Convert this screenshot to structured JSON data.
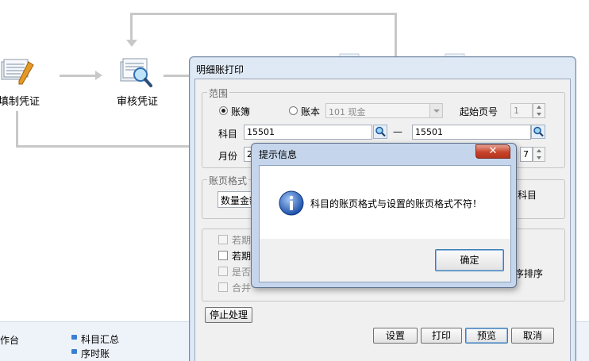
{
  "workflow": {
    "node_fill_voucher": "填制凭证",
    "node_audit_voucher": "审核凭证"
  },
  "workbench": {
    "label": "作台",
    "link_subject_summary": "科目汇总",
    "link_sequence_ledger": "序时账"
  },
  "print_dialog": {
    "title": "明细账打印",
    "range_group": {
      "legend": "范围",
      "radio_ledger": "账簿",
      "radio_book": "账本",
      "book_value": "101 现金",
      "start_page_label": "起始页号",
      "start_page_value": "1",
      "subject_label": "科目",
      "subject_from": "15501",
      "dash": "—",
      "subject_to": "15501",
      "month_label": "月份",
      "month_from_partial": "2(",
      "month_to_partial": "7"
    },
    "format_group": {
      "legend": "账页格式",
      "format_value_partial": "数量金额",
      "right_label_partial": "科目"
    },
    "options_group": {
      "opt1_partial": "若期",
      "opt2_partial": "若期",
      "opt3_partial": "是否",
      "opt4_partial": "合并",
      "right_label_partial": "序排序"
    },
    "buttons": {
      "stop": "停止处理",
      "settings": "设置",
      "print": "打印",
      "preview": "预览",
      "cancel": "取消"
    }
  },
  "alert": {
    "title": "提示信息",
    "close_glyph": "✕",
    "message": "科目的账页格式与设置的账页格式不符！",
    "ok_label": "确定",
    "icon": "info-icon"
  },
  "colors": {
    "accent": "#3b7fd1",
    "close_red": "#c7442c",
    "dialog_frame": "#dfe9f5"
  }
}
